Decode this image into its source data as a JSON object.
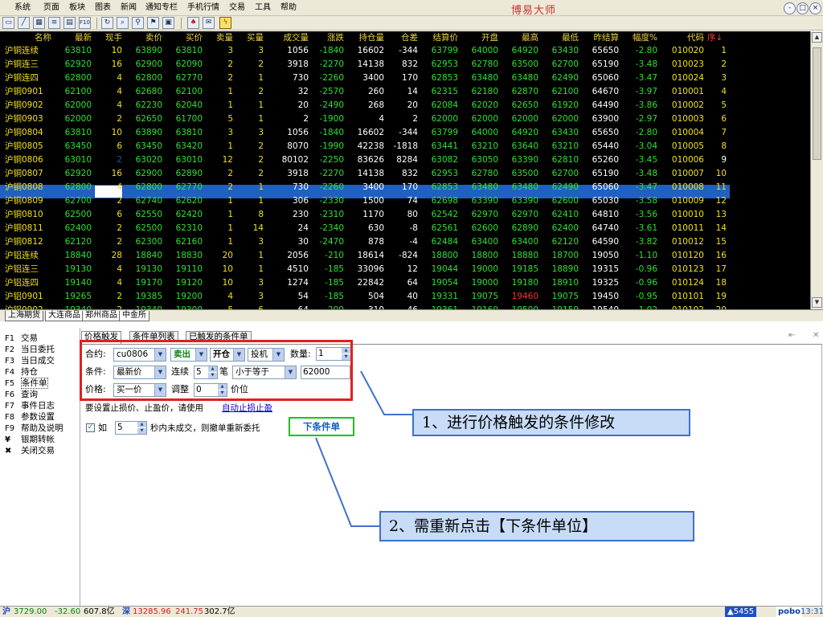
{
  "app": {
    "title": "博易大师"
  },
  "menu": [
    "系统",
    "页面",
    "板块",
    "图表",
    "新闻",
    "通知专栏",
    "手机行情",
    "交易",
    "工具",
    "帮助"
  ],
  "window_buttons": [
    "-",
    "□",
    "×"
  ],
  "toolbar_icons": [
    "new-icon",
    "chart-icon",
    "table-icon",
    "list-icon",
    "report-icon",
    "f10-icon",
    "refresh-icon",
    "search-icon",
    "zoom-icon",
    "alert-icon",
    "bell-icon",
    "news-icon",
    "lightning-icon"
  ],
  "columns": [
    "名称",
    "最新",
    "现手",
    "卖价",
    "买价",
    "卖量",
    "买量",
    "成交量",
    "涨跌",
    "持仓量",
    "仓差",
    "结算价",
    "开盘",
    "最高",
    "最低",
    "昨结算",
    "幅度%",
    "代码",
    "序↓"
  ],
  "rows": [
    [
      "沪铜连续",
      "63810",
      "10",
      "63890",
      "63810",
      "3",
      "3",
      "1056",
      "-1840",
      "16602",
      "-344",
      "63799",
      "64000",
      "64920",
      "63430",
      "65650",
      "-2.80",
      "010020",
      "1"
    ],
    [
      "沪铜连三",
      "62920",
      "16",
      "62900",
      "62090",
      "2",
      "2",
      "3918",
      "-2270",
      "14138",
      "832",
      "62953",
      "62780",
      "63500",
      "62700",
      "65190",
      "-3.48",
      "010023",
      "2"
    ],
    [
      "沪铜连四",
      "62800",
      "4",
      "62800",
      "62770",
      "2",
      "1",
      "730",
      "-2260",
      "3400",
      "170",
      "62853",
      "63480",
      "63480",
      "62490",
      "65060",
      "-3.47",
      "010024",
      "3"
    ],
    [
      "沪铜0901",
      "62100",
      "4",
      "62680",
      "62100",
      "1",
      "2",
      "32",
      "-2570",
      "260",
      "14",
      "62315",
      "62180",
      "62870",
      "62100",
      "64670",
      "-3.97",
      "010001",
      "4"
    ],
    [
      "沪铜0902",
      "62000",
      "4",
      "62230",
      "62040",
      "1",
      "1",
      "20",
      "-2490",
      "268",
      "20",
      "62084",
      "62020",
      "62650",
      "61920",
      "64490",
      "-3.86",
      "010002",
      "5"
    ],
    [
      "沪铜0903",
      "62000",
      "2",
      "62650",
      "61700",
      "5",
      "1",
      "2",
      "-1900",
      "4",
      "2",
      "62000",
      "62000",
      "62000",
      "62000",
      "63900",
      "-2.97",
      "010003",
      "6"
    ],
    [
      "沪铜0804",
      "63810",
      "10",
      "63890",
      "63810",
      "3",
      "3",
      "1056",
      "-1840",
      "16602",
      "-344",
      "63799",
      "64000",
      "64920",
      "63430",
      "65650",
      "-2.80",
      "010004",
      "7"
    ],
    [
      "沪铜0805",
      "63450",
      "6",
      "63450",
      "63420",
      "1",
      "2",
      "8070",
      "-1990",
      "42238",
      "-1818",
      "63441",
      "63210",
      "63640",
      "63210",
      "65440",
      "-3.04",
      "010005",
      "8"
    ],
    [
      "沪铜0806",
      "63010",
      "2",
      "63020",
      "63010",
      "12",
      "2",
      "80102",
      "-2250",
      "83626",
      "8284",
      "63082",
      "63050",
      "63390",
      "62810",
      "65260",
      "-3.45",
      "010006",
      "9"
    ],
    [
      "沪铜0807",
      "62920",
      "16",
      "62900",
      "62890",
      "2",
      "2",
      "3918",
      "-2270",
      "14138",
      "832",
      "62953",
      "62780",
      "63500",
      "62700",
      "65190",
      "-3.48",
      "010007",
      "10"
    ],
    [
      "沪铜0808",
      "62800",
      "4",
      "62800",
      "62770",
      "2",
      "1",
      "730",
      "-2260",
      "3400",
      "170",
      "62853",
      "63480",
      "63480",
      "62490",
      "65060",
      "-3.47",
      "010008",
      "11"
    ],
    [
      "沪铜0809",
      "62700",
      "2",
      "62740",
      "62620",
      "1",
      "1",
      "306",
      "-2330",
      "1500",
      "74",
      "62698",
      "63390",
      "63390",
      "62600",
      "65030",
      "-3.58",
      "010009",
      "12"
    ],
    [
      "沪铜0810",
      "62500",
      "6",
      "62550",
      "62420",
      "1",
      "8",
      "230",
      "-2310",
      "1170",
      "80",
      "62542",
      "62970",
      "62970",
      "62410",
      "64810",
      "-3.56",
      "010010",
      "13"
    ],
    [
      "沪铜0811",
      "62400",
      "2",
      "62500",
      "62310",
      "1",
      "14",
      "24",
      "-2340",
      "630",
      "-8",
      "62561",
      "62600",
      "62890",
      "62400",
      "64740",
      "-3.61",
      "010011",
      "14"
    ],
    [
      "沪铜0812",
      "62120",
      "2",
      "62300",
      "62160",
      "1",
      "3",
      "30",
      "-2470",
      "878",
      "-4",
      "62484",
      "63400",
      "63400",
      "62120",
      "64590",
      "-3.82",
      "010012",
      "15"
    ],
    [
      "沪铝连续",
      "18840",
      "28",
      "18840",
      "18830",
      "20",
      "1",
      "2056",
      "-210",
      "18614",
      "-824",
      "18800",
      "18800",
      "18880",
      "18700",
      "19050",
      "-1.10",
      "010120",
      "16"
    ],
    [
      "沪铝连三",
      "19130",
      "4",
      "19130",
      "19110",
      "10",
      "1",
      "4510",
      "-185",
      "33096",
      "12",
      "19044",
      "19000",
      "19185",
      "18890",
      "19315",
      "-0.96",
      "010123",
      "17"
    ],
    [
      "沪铝连四",
      "19140",
      "4",
      "19170",
      "19120",
      "10",
      "3",
      "1274",
      "-185",
      "22842",
      "64",
      "19054",
      "19000",
      "19180",
      "18910",
      "19325",
      "-0.96",
      "010124",
      "18"
    ],
    [
      "沪铝0901",
      "19265",
      "2",
      "19385",
      "19200",
      "4",
      "3",
      "54",
      "-185",
      "504",
      "40",
      "19331",
      "19075",
      "19460",
      "19075",
      "19450",
      "-0.95",
      "010101",
      "19"
    ]
  ],
  "partial_row": [
    "沪铝0902",
    "19340",
    "2",
    "19340",
    "19300",
    "5",
    "6",
    "64",
    "-200",
    "310",
    "46",
    "19361",
    "19160",
    "19500",
    "19150",
    "19540",
    "-1.02",
    "010102",
    "20"
  ],
  "selected_row_index": 8,
  "exchange_tabs": [
    "上海期货",
    "大连商品",
    "郑州商品",
    "中金所"
  ],
  "nav": [
    {
      "key": "F1",
      "label": "交易"
    },
    {
      "key": "F2",
      "label": "当日委托"
    },
    {
      "key": "F3",
      "label": "当日成交"
    },
    {
      "key": "F4",
      "label": "持仓"
    },
    {
      "key": "F5",
      "label": "条件单"
    },
    {
      "key": "F6",
      "label": "查询"
    },
    {
      "key": "F7",
      "label": "事件日志"
    },
    {
      "key": "F8",
      "label": "参数设置"
    },
    {
      "key": "F9",
      "label": "帮助及说明"
    },
    {
      "key": "¥",
      "label": "银期转帐"
    },
    {
      "key": "✖",
      "label": "关闭交易"
    }
  ],
  "panel_tabs": [
    "价格触发",
    "条件单列表",
    "已触发的条件单"
  ],
  "form": {
    "contract_label": "合约:",
    "contract_value": "cu0806",
    "direction_value": "卖出",
    "offset_value": "开仓",
    "hedge_value": "投机",
    "qty_label": "数量:",
    "qty_value": "1",
    "condition_label": "条件:",
    "condition_value": "最新价",
    "consecutive_label": "连续",
    "consecutive_value": "5",
    "consecutive_unit": "笔",
    "compare_value": "小于等于",
    "trigger_price": "62000",
    "price_label": "价格:",
    "price_value": "买一价",
    "adjust_label": "调整",
    "adjust_value": "0",
    "adjust_unit": "价位",
    "stop_hint": "要设置止损价、止盈价，请使用",
    "stop_link": "自动止损止盈",
    "retry_check": "如",
    "retry_value": "5",
    "retry_text": "秒内未成交，则撤单重新委托",
    "submit_label": "下条件单"
  },
  "callouts": {
    "one": "1、进行价格触发的条件修改",
    "two": "2、需重新点击【下条件单位】"
  },
  "status": {
    "sh_label": "沪",
    "sh_index": "3729.00",
    "sh_change": "-32.60",
    "sh_amount": "607.8亿",
    "sz_label": "深",
    "sz_index": "13285.96",
    "sz_change": "241.75",
    "sz_amount": "302.7亿",
    "count": "▲5455",
    "brand": "pobo",
    "time": "13:31"
  },
  "colors": {
    "up": "#ff3030",
    "down": "#30e030",
    "flat": "#ffffff",
    "name": "#f0e020",
    "code": "#f0e020",
    "header": "#e8d040",
    "selected": "#2060c0",
    "red_box": "#e02020",
    "callout_border": "#4070d0"
  }
}
